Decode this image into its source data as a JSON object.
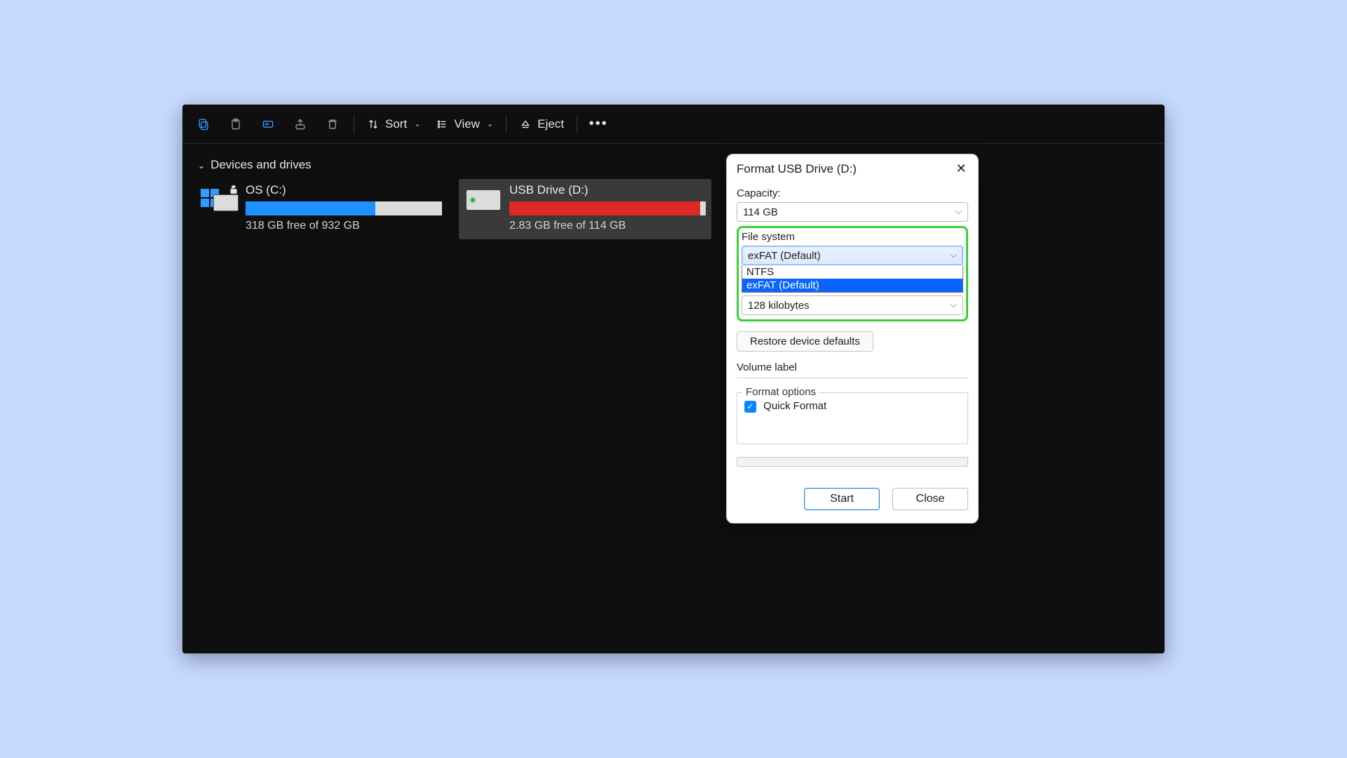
{
  "toolbar": {
    "sort_label": "Sort",
    "view_label": "View",
    "eject_label": "Eject"
  },
  "section": {
    "title": "Devices and drives"
  },
  "drives": [
    {
      "name": "OS (C:)",
      "free_text": "318 GB free of 932 GB",
      "used_pct": 66,
      "fill_color": "#1e90ff"
    },
    {
      "name": "USB Drive (D:)",
      "free_text": "2.83 GB free of 114 GB",
      "used_pct": 97,
      "fill_color": "#e02828"
    }
  ],
  "dialog": {
    "title": "Format USB Drive (D:)",
    "capacity_label": "Capacity:",
    "capacity_value": "114 GB",
    "fs_label": "File system",
    "fs_value": "exFAT (Default)",
    "fs_options": [
      "NTFS",
      "exFAT (Default)"
    ],
    "fs_selected_index": 1,
    "alloc_value": "128 kilobytes",
    "restore_label": "Restore device defaults",
    "volume_label": "Volume label",
    "format_options_label": "Format options",
    "quick_format_label": "Quick Format",
    "quick_format_checked": true,
    "start_label": "Start",
    "close_label": "Close"
  }
}
